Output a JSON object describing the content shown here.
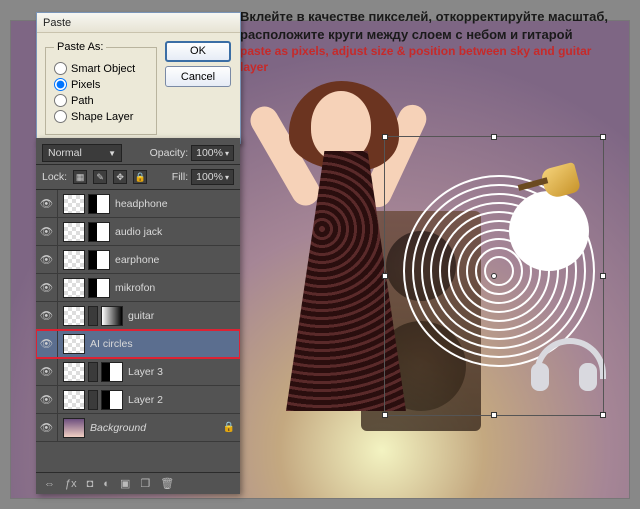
{
  "caption": {
    "ru": "Вклейте в качестве пикселей, откорректируйте масштаб, расположите круги между слоем с небом и гитарой",
    "en": "paste as pixels, adjust size & position between sky and guitar layer"
  },
  "dialog": {
    "title": "Paste",
    "legend": "Paste As:",
    "options": {
      "smart_object": "Smart Object",
      "pixels": "Pixels",
      "path": "Path",
      "shape_layer": "Shape Layer"
    },
    "selected": "pixels",
    "ok": "OK",
    "cancel": "Cancel"
  },
  "layers": {
    "blend_mode": "Normal",
    "opacity_label": "Opacity:",
    "opacity_value": "100%",
    "lock_label": "Lock:",
    "fill_label": "Fill:",
    "fill_value": "100%",
    "items": [
      {
        "name": "headphone",
        "masks": [
          "check",
          "mask"
        ]
      },
      {
        "name": "audio jack",
        "masks": [
          "check",
          "mask"
        ]
      },
      {
        "name": "earphone",
        "masks": [
          "check",
          "mask"
        ]
      },
      {
        "name": "mikrofon",
        "masks": [
          "check",
          "mask"
        ]
      },
      {
        "name": "guitar",
        "masks": [
          "check",
          "link",
          "mask2"
        ]
      },
      {
        "name": "AI circles",
        "masks": [
          "check"
        ],
        "selected": true
      },
      {
        "name": "Layer 3",
        "masks": [
          "check",
          "link",
          "mask"
        ]
      },
      {
        "name": "Layer 2",
        "masks": [
          "check",
          "link",
          "mask"
        ]
      },
      {
        "name": "Background",
        "masks": [
          "grad"
        ],
        "locked": true,
        "bg": true
      }
    ]
  }
}
